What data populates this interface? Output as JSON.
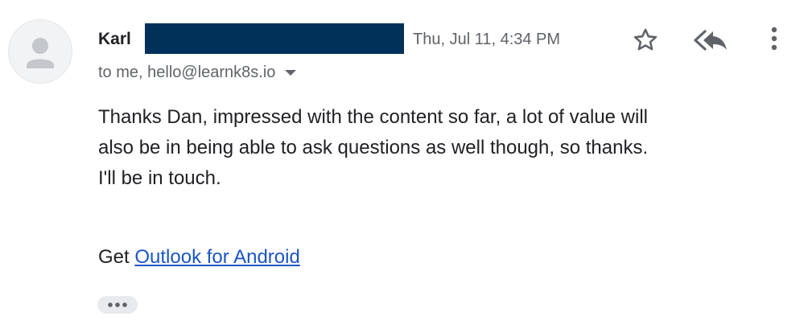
{
  "sender": {
    "name": "Karl",
    "redacted_color": "#003158"
  },
  "date": "Thu, Jul 11, 4:34 PM",
  "recipients": "to me, hello@learnk8s.io",
  "icons": {
    "avatar": "person-icon",
    "star": "star-outline-icon",
    "reply": "reply-all-icon",
    "more": "more-vertical-icon",
    "recipients_toggle": "caret-down-icon",
    "trimmed": "ellipsis-icon"
  },
  "body": {
    "lines": [
      "Thanks Dan, impressed with the content so far, a lot of value will",
      "also be in being able to ask questions as well though, so thanks.",
      "I'll be in touch."
    ],
    "signature_prefix": "Get ",
    "signature_link": "Outlook for Android"
  },
  "colors": {
    "link": "#1a55c5",
    "muted_text": "#5f6368",
    "text": "#202124",
    "redaction": "#003158"
  }
}
